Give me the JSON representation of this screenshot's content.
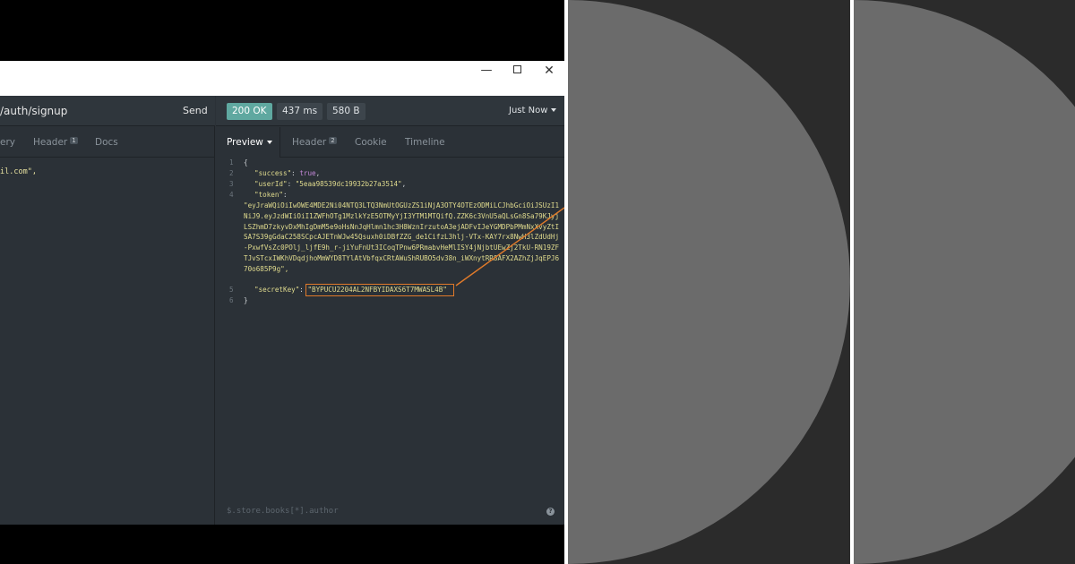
{
  "window": {
    "minimize": "—",
    "close": "✕"
  },
  "request": {
    "url": "/auth/signup",
    "send_label": "Send",
    "tabs": [
      {
        "label": "ery"
      },
      {
        "label": "Header",
        "badge": "1"
      },
      {
        "label": "Docs"
      }
    ],
    "body_fragment": "il.com\","
  },
  "response": {
    "status": "200 OK",
    "time": "437 ms",
    "size": "580 B",
    "history": "Just Now",
    "tabs": [
      {
        "label": "Preview"
      },
      {
        "label": "Header",
        "badge": "2"
      },
      {
        "label": "Cookie"
      },
      {
        "label": "Timeline"
      }
    ],
    "json": {
      "open_brace": "{",
      "close_brace": "}",
      "success_key": "\"success\"",
      "success_value": "true",
      "userId_key": "\"userId\"",
      "userId_value": "\"5eaa98539dc19932b27a3514\"",
      "token_key": "\"token\"",
      "token_value": "\"eyJraWQiOiIwOWE4MDE2Ni04NTQ3LTQ3NmUtOGUzZS1iNjA3OTY4OTEzODMiLCJhbGciOiJSUzI1NiJ9.eyJzdWIiOiI1ZWFhOTg1MzlkYzE5OTMyYjI3YTM1MTQifQ.ZZK6c3VnU5aQLsGn8Sa79KJyjLSZhmD7zkyvDxMhIgDmM5e9oHsNnJqHlmn1hc3H8WznIrzutoA3ejADFvIJeYGMDPbPMmNxXvyZtISA7S39gGdaC258SCpcAJETnWJw45Qsuxh0iDBfZZG_de1CifzL3hlj-VTx-KAY7rx8NwH3lZdUdHj-PxwfVsZc0POlj_ljfE9h_r-jiYuFnUt3ICoqTPnw6PRmabvHeMlISY4jNjbtUEwZj2TkU-RN19ZFTJvSTcxIWKhVDqdjhoMmWYD8TYlAtVbfqxCRtAWuShRUBO5dv38n_iWXnytRR8AFX2AZhZjJqEPJ670o685P9g\",",
      "secretKey_key": "\"secretKey\"",
      "secretKey_value": "\"BYPUCU2204AL2NFBYIDAXS6T7MWASL4B\"",
      "line_numbers": [
        "1",
        "2",
        "3",
        "4",
        "5",
        "6"
      ]
    },
    "filter_placeholder": "$.store.books[*].author",
    "help_glyph": "?"
  },
  "colors": {
    "status_ok": "#5fa8a0",
    "highlight": "#e07a2a",
    "panel": "#2b3137"
  }
}
